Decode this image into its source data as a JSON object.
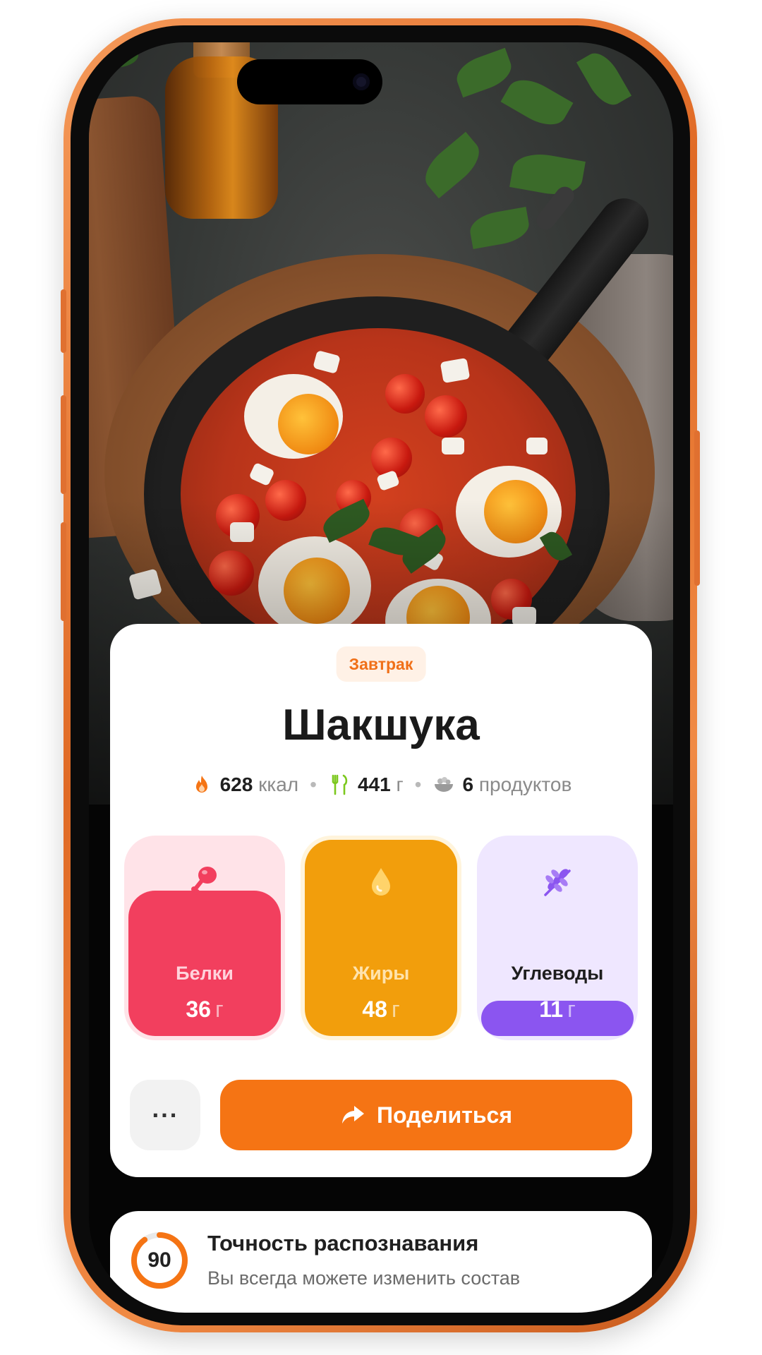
{
  "meal_badge": "Завтрак",
  "dish_title": "Шакшука",
  "meta": {
    "calories_value": "628",
    "calories_unit": "ккал",
    "weight_value": "441",
    "weight_unit": "г",
    "products_value": "6",
    "products_unit": "продуктов"
  },
  "macros": [
    {
      "label": "Белки",
      "value": "36",
      "unit": "г",
      "fill_fraction": 0.74,
      "color": "#f23f5e",
      "bg": "#ffe3e8",
      "label_color": "#ffd3dc",
      "icon": "drumstick-icon"
    },
    {
      "label": "Жиры",
      "value": "48",
      "unit": "г",
      "fill_fraction": 1.0,
      "color": "#f29e0c",
      "bg": "#fff4dc",
      "label_color": "#ffe3ad",
      "icon": "drop-icon"
    },
    {
      "label": "Углеводы",
      "value": "11",
      "unit": "г",
      "fill_fraction": 0.18,
      "color": "#8b55f0",
      "bg": "#efe7ff",
      "label_color": "#1e1e1e",
      "icon": "wheat-icon"
    }
  ],
  "actions": {
    "more_label": "···",
    "share_label": "Поделиться"
  },
  "accuracy": {
    "score": "90",
    "score_fraction": 0.9,
    "title": "Точность распознавания",
    "subtitle": "Вы всегда можете изменить состав"
  },
  "colors": {
    "accent": "#f57414",
    "frame": "#e06a25"
  }
}
